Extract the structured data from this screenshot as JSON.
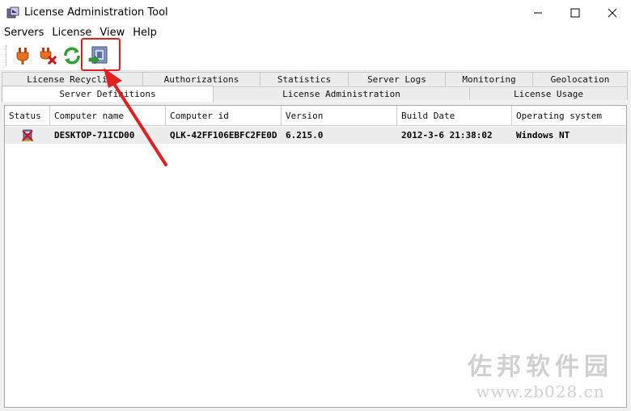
{
  "window": {
    "title": "License Administration Tool"
  },
  "menu": [
    "Servers",
    "License",
    "View",
    "Help"
  ],
  "toolbar": {
    "buttons": [
      "connect-plug-icon",
      "disconnect-plug-icon",
      "refresh-icon",
      "import-license-icon"
    ],
    "highlight_color": "#e02020"
  },
  "tabs": {
    "row1": [
      "License Recycling",
      "Authorizations",
      "Statistics",
      "Server Logs",
      "Monitoring",
      "Geolocation"
    ],
    "row2": [
      "Server Definitions",
      "License Administration",
      "License Usage"
    ],
    "active": "Server Definitions"
  },
  "table": {
    "columns": [
      "Status",
      "Computer name",
      "Computer id",
      "Version",
      "Build Date",
      "Operating system"
    ],
    "rows": [
      {
        "status_icon": "server-error-icon",
        "computer_name": "DESKTOP-71ICD00",
        "computer_id": "QLK-42FF106EBFC2FE0D",
        "version": "6.215.0",
        "build_date": "2012-3-6 21:38:02",
        "os": "Windows NT"
      }
    ]
  },
  "watermark": {
    "cn": "佐邦软件园",
    "url": "www.zb028.cn"
  }
}
